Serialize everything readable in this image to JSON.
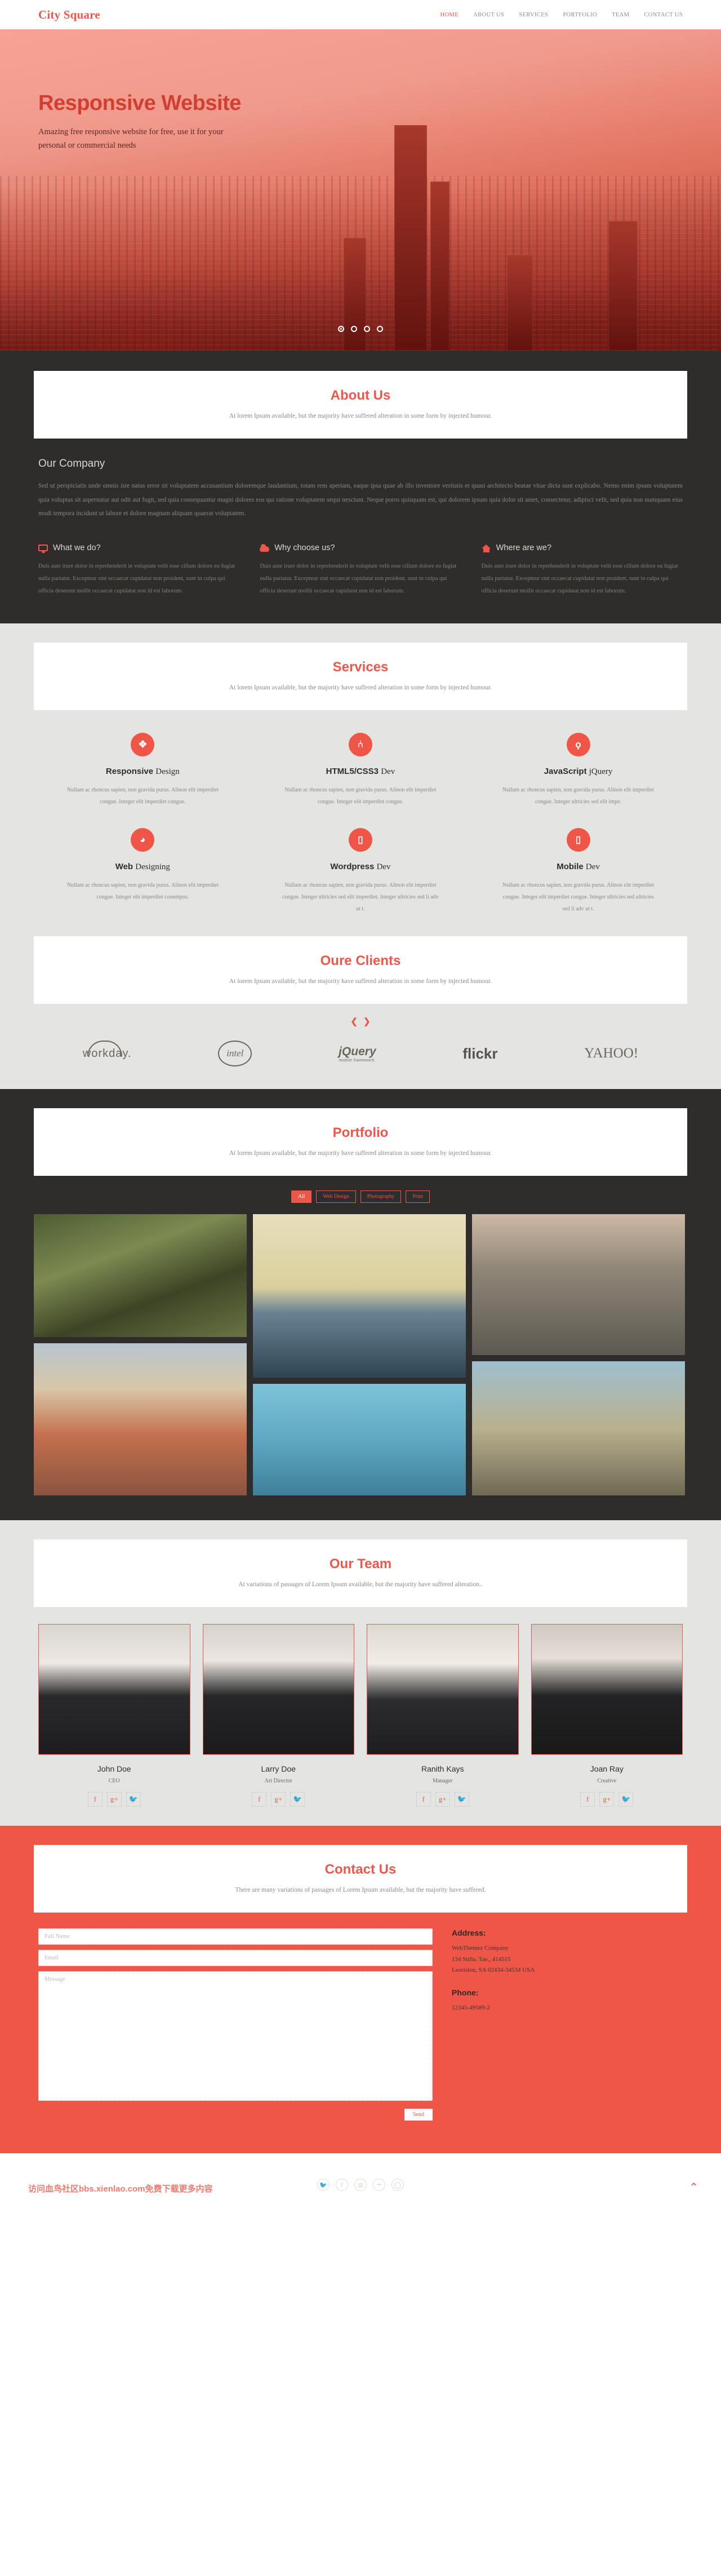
{
  "header": {
    "logo": "City Square",
    "nav": [
      {
        "label": "HOME",
        "active": true
      },
      {
        "label": "ABOUT US",
        "active": false
      },
      {
        "label": "SERVICES",
        "active": false
      },
      {
        "label": "PORTFOLIO",
        "active": false
      },
      {
        "label": "TEAM",
        "active": false
      },
      {
        "label": "CONTACT US",
        "active": false
      }
    ]
  },
  "hero": {
    "title": "Responsive Website",
    "subtitle": "Amazing free responsive website for free, use it for your personal or commercial needs",
    "dots": 4,
    "active_dot": 0
  },
  "about": {
    "title": "About Us",
    "subtitle": "At lorem Ipsum available, but the majority have suffered alteration in some form by injected humour.",
    "company_heading": "Our Company",
    "company_text": "Sed ut perspiciatis unde omnis iste natus error sit voluptatem accusantium doloremque laudantium, totam rem aperiam, eaque ipsa quae ab illo inventore veritatis et quasi architecto beatae vitae dicta sunt explicabo. Nemo enim ipsam voluptatem quia voluptas sit aspernatur aut odit aut fugit, sed quia consequuntur magni dolores eos qui ratione voluptatem sequi nesciunt. Neque porro quisquam est, qui dolorem ipsum quia dolor sit amet, consectetur, adipisci velit, sed quia non numquam eius modi tempora incidunt ut labore et dolore magnam aliquam quaerat voluptatem.",
    "columns": [
      {
        "icon": "monitor-icon",
        "title": "What we do?",
        "text": "Duis aute irure dolor in reprehenderit in voluptate velit esse cillum dolore eu fugiat nulla pariatur. Excepteur sint occaecat cupidatat non proident, sunt in culpa qui officia deserunt mollit occaecat cupidatat non id est laborum."
      },
      {
        "icon": "cloud-icon",
        "title": "Why choose us?",
        "text": "Duis aute irure dolor in reprehenderit in voluptate velit esse cillum dolore eu fugiat nulla pariatur. Excepteur sint occaecat cupidatat non proident, sunt in culpa qui officia deserunt mollit occaecat cupidatat non id est laborum."
      },
      {
        "icon": "home-icon",
        "title": "Where are we?",
        "text": "Duis aute irure dolor in reprehenderit in voluptate velit esse cillum dolore eu fugiat nulla pariatur. Excepteur sint occaecat cupidatat non proident, sunt in culpa qui officia deserunt mollit occaecat cupidatat non id est laborum."
      }
    ]
  },
  "services": {
    "title": "Services",
    "subtitle": "At lorem Ipsum available, but the majority have suffered alteration in some form by injected humour.",
    "items": [
      {
        "icon": "arrows-move-icon",
        "glyph": "✥",
        "name_strong": "Responsive",
        "name_light": "Design",
        "text": "Nullam ac rhoncus sapien, non gravida purus. Alinon elit imperdiet congue. Integer elit imperdiet congue."
      },
      {
        "icon": "css3-icon",
        "glyph": "⑃",
        "name_strong": "HTML5/CSS3",
        "name_light": "Dev",
        "text": "Nullam ac rhoncus sapien, non gravida purus. Alinon elit imperdiet congue. Integer elit imperdiet congue."
      },
      {
        "icon": "lightbulb-icon",
        "glyph": "ϙ",
        "name_strong": "JavaScript",
        "name_light": "jQuery",
        "text": "Nullam ac rhoncus sapien, non gravida purus. Alinon elit imperdiet congue. Integer ultricies sed elit impe."
      },
      {
        "icon": "paint-globe-icon",
        "glyph": "◕",
        "name_strong": "Web",
        "name_light": "Designing",
        "text": "Nullam ac rhoncus sapien, non gravida purus. Alinon elit imperdiet congue. Integer elit imperdiet conempus."
      },
      {
        "icon": "tablet-icon",
        "glyph": "▯",
        "name_strong": "Wordpress",
        "name_light": "Dev",
        "text": "Nullam ac rhoncus sapien, non gravida purus. Alinon elit imperdiet congue. Integer ultricies sed elit imperdiet. Integer ultricies sed li adv ut t."
      },
      {
        "icon": "mobile-icon",
        "glyph": "▯",
        "name_strong": "Mobile",
        "name_light": "Dev",
        "text": "Nullam ac rhoncus sapien, non gravida purus. Alinon elit imperdiet congue. Integer elit imperdiet congue. Integer ultricies sed ultricies sed li adv ut t."
      }
    ]
  },
  "clients": {
    "title": "Oure Clients",
    "subtitle": "At lorem Ipsum available, but the majority have suffered alteration in some form by injected humour.",
    "prev_arrow": "❮",
    "next_arrow": "❯",
    "logos": [
      {
        "name": "workday",
        "text": "workday."
      },
      {
        "name": "intel",
        "text": "intel"
      },
      {
        "name": "jquery-mobile",
        "text": "jQuery",
        "sub": "mobile framework."
      },
      {
        "name": "flickr",
        "text": "flickr"
      },
      {
        "name": "yahoo",
        "text": "YAHOO!"
      }
    ]
  },
  "portfolio": {
    "title": "Portfolio",
    "subtitle": "At lorem Ipsum available, but the majority have suffered alteration in some form by injected humour.",
    "filters": [
      {
        "label": "All",
        "active": true
      },
      {
        "label": "Web Design",
        "active": false
      },
      {
        "label": "Photography",
        "active": false
      },
      {
        "label": "Print",
        "active": false
      }
    ]
  },
  "team": {
    "title": "Our Team",
    "subtitle": "At variations of passages of Lorem Ipsum available, but the majority have suffered alteration..",
    "members": [
      {
        "name": "John Doe",
        "role": "CEO",
        "socials": [
          "f",
          "g+",
          "t"
        ]
      },
      {
        "name": "Larry Doe",
        "role": "Art Director",
        "socials": [
          "f",
          "g+",
          "t"
        ]
      },
      {
        "name": "Ranith Kays",
        "role": "Manager",
        "socials": [
          "f",
          "g+",
          "t"
        ]
      },
      {
        "name": "Joan Ray",
        "role": "Creative",
        "socials": [
          "f",
          "g+",
          "t"
        ]
      }
    ]
  },
  "contact": {
    "title": "Contact Us",
    "subtitle": "There are many variations of passages of Lorem Ipsum available, but the majority have suffered.",
    "form": {
      "name_placeholder": "Full Name",
      "email_placeholder": "Email",
      "message_placeholder": "Message",
      "send_label": "Send"
    },
    "address_label": "Address:",
    "address_lines": "WebThemez Company\n134 Stilla. Tae., 414515\nLeorislon, SA 02434-34534 USA",
    "phone_label": "Phone:",
    "phone": "12345-49589-2"
  },
  "footer": {
    "watermark": "访问血鸟社区bbs.xienlao.com免费下载更多内容",
    "socials": [
      {
        "name": "twitter-icon",
        "glyph": "🐦"
      },
      {
        "name": "facebook-icon",
        "glyph": "f"
      },
      {
        "name": "dribbble-icon",
        "glyph": "◎"
      },
      {
        "name": "flickr-icon",
        "glyph": "••"
      },
      {
        "name": "github-icon",
        "glyph": "◯"
      }
    ],
    "to_top": "⌃"
  },
  "colors": {
    "accent": "#ef5647",
    "dark": "#2f2d2b",
    "light": "#e4e4e2"
  }
}
